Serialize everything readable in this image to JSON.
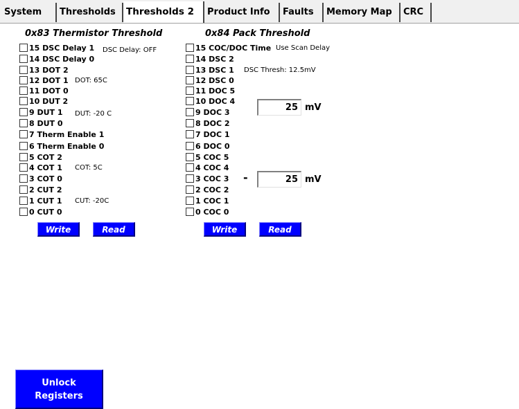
{
  "tabs": [
    "System",
    "Thresholds",
    "Thresholds 2",
    "Product Info",
    "Faults",
    "Memory Map",
    "CRC"
  ],
  "active_tab": "Thresholds 2",
  "thermistor": {
    "title": "0x83 Thermistor Threshold",
    "bits": [
      "15 DSC Delay 1",
      "14 DSC Delay 0",
      "13 DOT 2",
      "12 DOT 1",
      "11 DOT 0",
      "10 DUT 2",
      "9 DUT 1",
      "8 DUT 0",
      "7 Therm Enable 1",
      "6 Therm Enable 0",
      "5 COT 2",
      "4 COT 1",
      "3 COT 0",
      "2 CUT 2",
      "1 CUT 1",
      "0 CUT 0"
    ],
    "notes": {
      "dsc_delay": "DSC Delay: OFF",
      "dot": "DOT: 65C",
      "dut": "DUT: -20 C",
      "cot": "COT: 5C",
      "cut": "CUT: -20C"
    },
    "write_label": "Write",
    "read_label": "Read"
  },
  "pack": {
    "title": "0x84 Pack Threshold",
    "bits": [
      "15 COC/DOC Time",
      "14 DSC 2",
      "13 DSC 1",
      "12 DSC 0",
      "11 DOC 5",
      "10 DOC 4",
      "9 DOC 3",
      "8 DOC 2",
      "7 DOC 1",
      "6 DOC 0",
      "5 COC 5",
      "4 COC 4",
      "3 COC 3",
      "2 COC 2",
      "1 COC 1",
      "0 COC 0"
    ],
    "notes": {
      "time": "Use Scan Delay",
      "dsc": "DSC Thresh: 12.5mV"
    },
    "doc_value": "25",
    "doc_unit": "mV",
    "coc_sign": "-",
    "coc_value": "25",
    "coc_unit": "mV",
    "write_label": "Write",
    "read_label": "Read"
  },
  "unlock": {
    "line1": "Unlock",
    "line2": "Registers"
  }
}
